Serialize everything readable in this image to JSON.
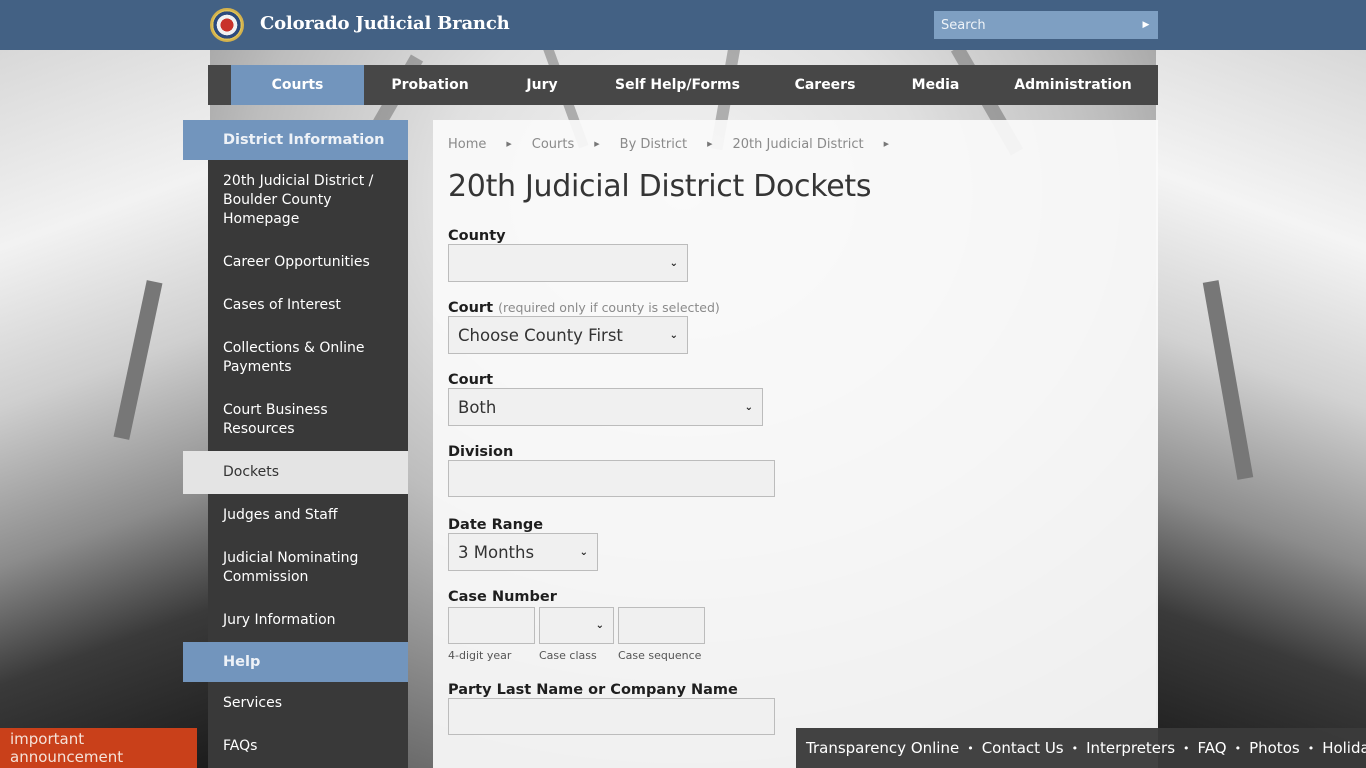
{
  "header": {
    "logo_alt": "Colorado Courts seal",
    "site_title": "Colorado Judicial Branch",
    "search": {
      "placeholder": "Search",
      "value": "",
      "button_icon": "caret-right-icon"
    }
  },
  "colors": {
    "header_bg": "#436184",
    "accent_blue": "#7295bd",
    "nav_bg": "#474747",
    "sidebar_bg": "#393939",
    "announcement_bg": "#c9401a"
  },
  "main_nav": {
    "items": [
      {
        "label": "Courts",
        "active": true
      },
      {
        "label": "Probation",
        "active": false
      },
      {
        "label": "Jury",
        "active": false
      },
      {
        "label": "Self Help/Forms",
        "active": false
      },
      {
        "label": "Careers",
        "active": false
      },
      {
        "label": "Media",
        "active": false
      },
      {
        "label": "Administration",
        "active": false
      }
    ]
  },
  "sidebar": {
    "section_1_title": "District Information",
    "section_1_items": [
      {
        "label": "20th Judicial District / Boulder County Homepage"
      },
      {
        "label": "Career Opportunities"
      },
      {
        "label": "Cases of Interest"
      },
      {
        "label": "Collections & Online Payments"
      },
      {
        "label": "Court Business Resources"
      },
      {
        "label": "Dockets",
        "active": true
      },
      {
        "label": "Judges and Staff"
      },
      {
        "label": "Judicial Nominating Commission"
      },
      {
        "label": "Jury Information"
      }
    ],
    "section_2_title": "Help",
    "section_2_items": [
      {
        "label": "Services"
      },
      {
        "label": "FAQs"
      }
    ]
  },
  "breadcrumb": [
    "Home",
    "Courts",
    "By District",
    "20th Judicial District"
  ],
  "page_title": "20th Judicial District Dockets",
  "form": {
    "county": {
      "label": "County",
      "value": ""
    },
    "court_location": {
      "label": "Court",
      "hint": "(required only if county is selected)",
      "value": "Choose County First"
    },
    "court_type": {
      "label": "Court",
      "value": "Both"
    },
    "division": {
      "label": "Division",
      "value": ""
    },
    "date_range": {
      "label": "Date Range",
      "value": "3 Months"
    },
    "case_number": {
      "label": "Case Number",
      "year": {
        "value": "",
        "sublabel": "4-digit year"
      },
      "class": {
        "value": "",
        "sublabel": "Case class"
      },
      "sequence": {
        "value": "",
        "sublabel": "Case sequence"
      }
    },
    "party_name": {
      "label": "Party Last Name or Company Name",
      "value": ""
    }
  },
  "announcement": "important announcement",
  "footer_links": [
    "Transparency Online",
    "Contact Us",
    "Interpreters",
    "FAQ",
    "Photos",
    "Holidays"
  ]
}
